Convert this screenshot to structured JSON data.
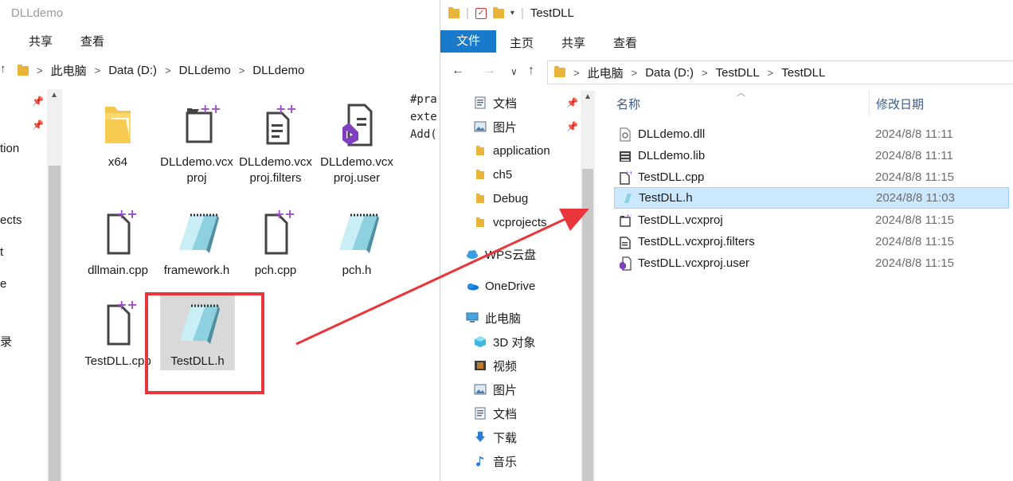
{
  "left_window": {
    "title": "DLLdemo",
    "tabs": [
      "共享",
      "查看"
    ],
    "breadcrumb": [
      "此电脑",
      "Data (D:)",
      "DLLdemo",
      "DLLdemo"
    ],
    "nav_stubs": [
      "tion",
      "ects",
      "t",
      "e",
      "录"
    ],
    "icons": [
      {
        "label": "x64",
        "type": "folder"
      },
      {
        "label": "DLLdemo.vcxproj",
        "type": "vcxproj"
      },
      {
        "label": "DLLdemo.vcxproj.filters",
        "type": "filters"
      },
      {
        "label": "DLLdemo.vcxproj.user",
        "type": "user"
      },
      {
        "label": "dllmain.cpp",
        "type": "cpp"
      },
      {
        "label": "framework.h",
        "type": "header"
      },
      {
        "label": "pch.cpp",
        "type": "cpp"
      },
      {
        "label": "pch.h",
        "type": "header"
      },
      {
        "label": "TestDLL.cpp",
        "type": "cpp"
      },
      {
        "label": "TestDLL.h",
        "type": "header",
        "selected": true
      }
    ],
    "code_peek": [
      "#pra",
      "exte",
      "Add("
    ]
  },
  "right_window": {
    "title": "TestDLL",
    "ribbon_tabs": {
      "file": "文件",
      "home": "主页",
      "share": "共享",
      "view": "查看"
    },
    "breadcrumb": [
      "此电脑",
      "Data (D:)",
      "TestDLL",
      "TestDLL"
    ],
    "nav_items": [
      {
        "label": "文档",
        "icon": "documents-icon",
        "pinned": true
      },
      {
        "label": "图片",
        "icon": "pictures-icon",
        "pinned": true
      },
      {
        "label": "application",
        "icon": "folder-icon"
      },
      {
        "label": "ch5",
        "icon": "folder-icon"
      },
      {
        "label": "Debug",
        "icon": "folder-icon"
      },
      {
        "label": "vcprojects",
        "icon": "folder-icon"
      },
      {
        "label": "WPS云盘",
        "icon": "cloud-icon"
      },
      {
        "label": "OneDrive",
        "icon": "onedrive-icon"
      },
      {
        "label": "此电脑",
        "icon": "computer-icon"
      },
      {
        "label": "3D 对象",
        "icon": "3d-objects-icon"
      },
      {
        "label": "视频",
        "icon": "video-icon"
      },
      {
        "label": "图片",
        "icon": "pictures-icon"
      },
      {
        "label": "文档",
        "icon": "documents-icon"
      },
      {
        "label": "下载",
        "icon": "download-icon"
      },
      {
        "label": "音乐",
        "icon": "music-icon"
      }
    ],
    "columns": {
      "name": "名称",
      "modified": "修改日期"
    },
    "files": [
      {
        "name": "DLLdemo.dll",
        "date": "2024/8/8 11:11",
        "icon": "dll-icon"
      },
      {
        "name": "DLLdemo.lib",
        "date": "2024/8/8 11:11",
        "icon": "lib-icon"
      },
      {
        "name": "TestDLL.cpp",
        "date": "2024/8/8 11:15",
        "icon": "cpp-file-icon"
      },
      {
        "name": "TestDLL.h",
        "date": "2024/8/8 11:03",
        "icon": "header-file-icon",
        "selected": true
      },
      {
        "name": "TestDLL.vcxproj",
        "date": "2024/8/8 11:15",
        "icon": "vcxproj-icon"
      },
      {
        "name": "TestDLL.vcxproj.filters",
        "date": "2024/8/8 11:15",
        "icon": "filters-icon"
      },
      {
        "name": "TestDLL.vcxproj.user",
        "date": "2024/8/8 11:15",
        "icon": "user-file-icon"
      }
    ]
  },
  "colors": {
    "accent": "#1979ca",
    "annotation_red": "#e8363a",
    "selection": "#cce8ff",
    "folder": "#e8b43a"
  }
}
